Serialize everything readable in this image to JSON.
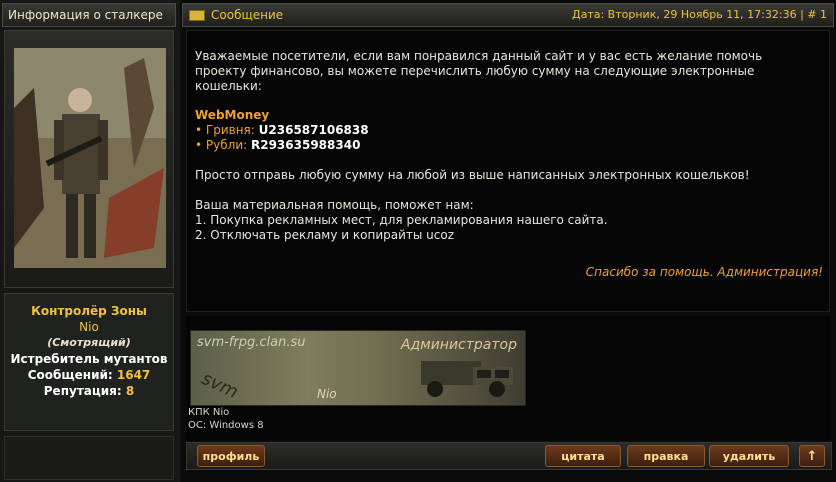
{
  "left": {
    "header": "Информация о сталкере",
    "rank": "Контролёр Зоны",
    "nick": "Nio",
    "title": "(Смотрящий)",
    "honor": "Истребитель мутантов",
    "messages_label": "Сообщений:",
    "messages_value": "1647",
    "reputation_label": "Репутация:",
    "reputation_value": "8"
  },
  "post": {
    "header_title": "Сообщение",
    "date": "Дата: Вторник, 29 Ноябрь 11, 17:32:36 | # 1",
    "intro": "Уважаемые посетители, если вам понравился данный сайт и у вас есть желание помочь проекту финансово, вы можете перечислить любую сумму на следующие электронные кошельки:",
    "webmoney": "WebMoney",
    "uah_label": "Гривня:",
    "uah_value": "U236587106838",
    "rub_label": "Рубли:",
    "rub_value": "R293635988340",
    "send": "Просто отправь любую сумму на любой из выше написанных электронных кошельков!",
    "help_title": "Ваша материальная помощь, поможет нам:",
    "help_1": "1. Покупка рекламных мест, для рекламирования нашего сайта.",
    "help_2": "2. Отключать рекламу и копирайты ucoz",
    "thanks": "Спасибо за помощь. Администрация!"
  },
  "signature": {
    "banner_url": "svm-frpg.clan.su",
    "banner_role": "Администратор",
    "banner_svm": "svm",
    "banner_nick": "Nio",
    "line1": "КПК Nio",
    "line2": "ОС: Windows 8"
  },
  "buttons": {
    "profile": "профиль",
    "quote": "цитата",
    "edit": "правка",
    "delete": "удалить",
    "up": "↑"
  },
  "colors": {
    "accent": "#f0c23a",
    "link_orange": "#f0a030"
  }
}
